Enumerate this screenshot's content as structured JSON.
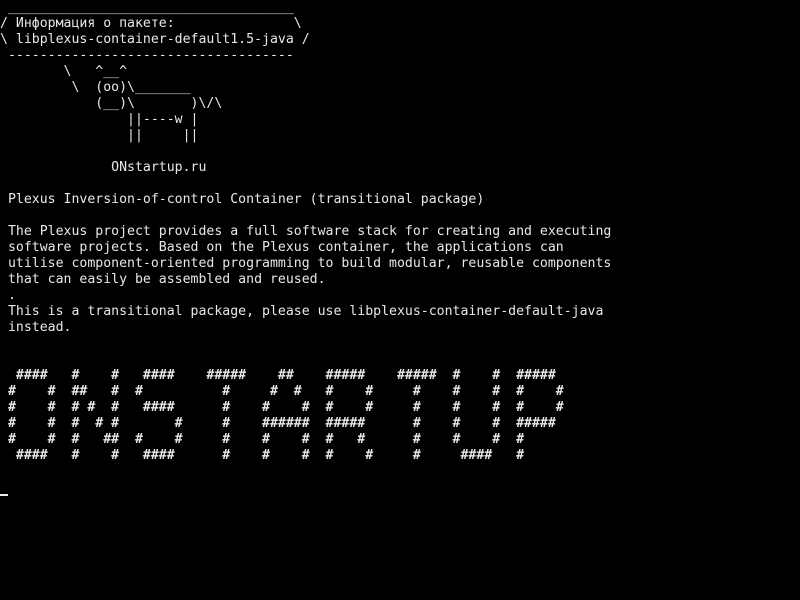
{
  "terminal": {
    "cowsay": [
      " ____________________________________",
      "/ Информация о пакете:               \\",
      "\\ libplexus-container-default1.5-java /",
      " ------------------------------------",
      "        \\   ^__^",
      "         \\  (oo)\\_______",
      "            (__)\\       )\\/\\",
      "                ||----w |",
      "                ||     ||",
      "",
      "              ONstartup.ru"
    ],
    "description": [
      "",
      " Plexus Inversion-of-control Container (transitional package)",
      "",
      " The Plexus project provides a full software stack for creating and executing",
      " software projects. Based on the Plexus container, the applications can",
      " utilise component-oriented programming to build modular, reusable components",
      " that can easily be assembled and reused.",
      " .",
      " This is a transitional package, please use libplexus-container-default-java",
      " instead."
    ],
    "banner": [
      "  ####   #    #   ####    #####    ##    #####    #####  #    #  #####",
      " #    #  ##   #  #          #     #  #   #    #     #    #    #  #    #",
      " #    #  # #  #   ####      #    #    #  #    #     #    #    #  #    #",
      " #    #  #  # #       #     #    ######  #####      #    #    #  #####",
      " #    #  #   ##  #    #     #    #    #  #   #      #    #    #  #",
      "  ####   #    #   ####      #    #    #  #    #     #     ####   #"
    ]
  }
}
